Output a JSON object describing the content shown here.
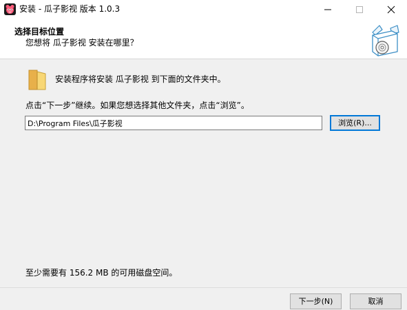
{
  "window": {
    "title": "安装 - 瓜子影视 版本 1.0.3",
    "icons": {
      "app": "app-icon",
      "minimize": "minimize-icon",
      "maximize": "maximize-icon",
      "close": "close-icon"
    }
  },
  "header": {
    "title": "选择目标位置",
    "subtitle": "您想将 瓜子影视 安装在哪里？",
    "icon": "install-box-icon"
  },
  "body": {
    "folder_icon": "folder-icon",
    "intro": "安装程序将安装 瓜子影视 到下面的文件夹中。",
    "instruction": "点击“下一步”继续。如果您想选择其他文件夹，点击“浏览”。",
    "path_value": "D:\\Program Files\\瓜子影视",
    "browse_label": "浏览(R)...",
    "space_required": "至少需要有 156.2 MB 的可用磁盘空间。"
  },
  "footer": {
    "next_label": "下一步(N)",
    "cancel_label": "取消"
  },
  "colors": {
    "accent": "#0078d7",
    "window_bg": "#f0f0f0",
    "header_bg": "#ffffff",
    "button_bg": "#e1e1e1"
  }
}
